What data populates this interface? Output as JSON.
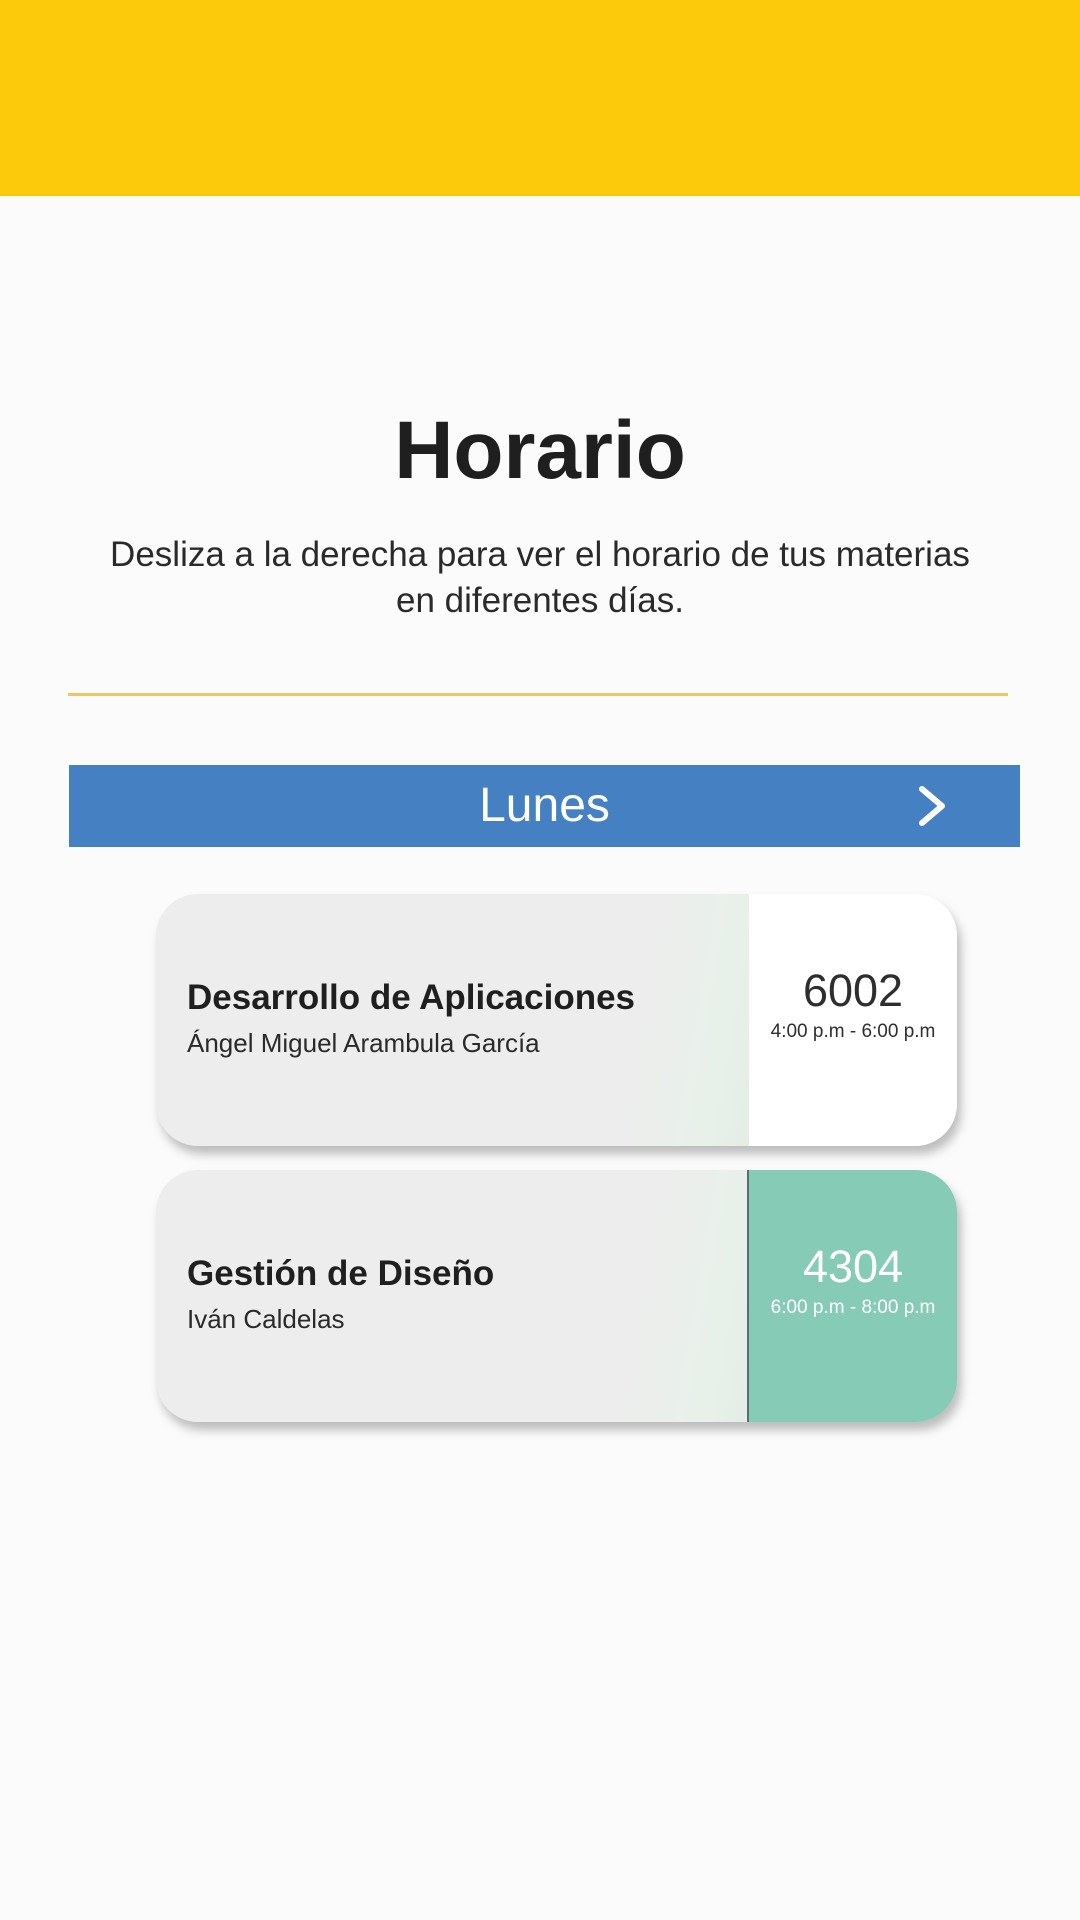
{
  "header": {
    "color": "#fdc90b"
  },
  "page": {
    "title": "Horario",
    "subtitle_line1": "Desliza a la derecha para ver el horario de tus materias",
    "subtitle_line2": "en diferentes días."
  },
  "day_selector": {
    "label": "Lunes",
    "next_icon": "chevron-right-icon",
    "color": "#4580c3"
  },
  "classes": [
    {
      "name": "Desarrollo de Aplicaciones",
      "teacher": "Ángel Miguel Arambula García",
      "room": "6002",
      "time": "4:00 p.m - 6:00 p.m",
      "slot_color": "#ffffff"
    },
    {
      "name": "Gestión de Diseño",
      "teacher": "Iván Caldelas",
      "room": "4304",
      "time": "6:00 p.m - 8:00 p.m",
      "slot_color": "#86cbb6"
    }
  ]
}
